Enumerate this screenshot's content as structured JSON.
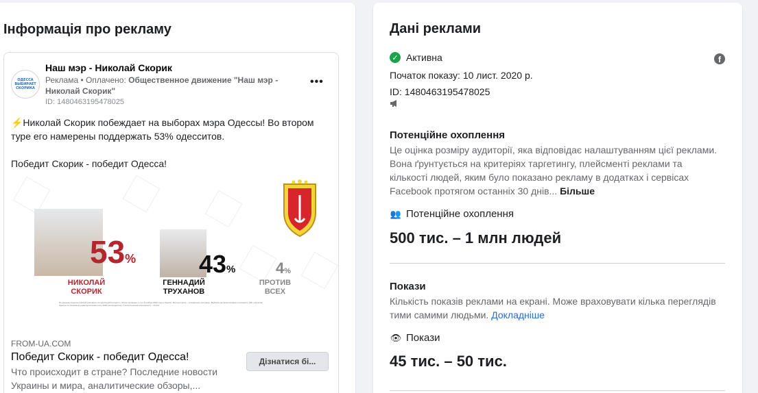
{
  "left": {
    "title": "Інформація про рекламу",
    "ad": {
      "avatar_text": [
        "ОДЕССА",
        "ВЫБИРАЕТ",
        "СКОРИКА"
      ],
      "page_name": "Наш мэр - Николай Скорик",
      "sponsor_prefix": "Реклама • Оплачено:",
      "sponsor_name": "Общественное движение \"Наш мэр - Николай Скорик\"",
      "ad_id": "ID: 1480463195478025",
      "more": "•••",
      "text_p1": "⚡Николай Скорик побеждает на выборах мэра Одессы! Во втором туре его намерены поддержать 53% одесситов.",
      "text_p2": "Победит Скорик - победит Одесса!",
      "creative": {
        "c1_pct": "53",
        "c1_name_line1": "НИКОЛАЙ",
        "c1_name_line2": "СКОРИК",
        "c2_pct": "43",
        "c2_name_line1": "ГЕННАДИЙ",
        "c2_name_line2": "ТРУХАНОВ",
        "c3_pct": "4",
        "c3_name_line1": "ПРОТИВ",
        "c3_name_line2": "ВСЕХ",
        "pct_sign": "%",
        "fine_print": "По данным социологической компании «Социальный Контекст». Опрос проведен с 1 по 6 ноября 2020 года в Одессе. Метод опроса – телефонное интервью. Выборка репрезентативна по возрасту (18+) жителям Одессы по основным характеристикам (полу 2000 респондентов). Статистическая погрешность – ±2.2%."
      },
      "domain": "FROM-UA.COM",
      "link_title": "Победит Скорик - победит Одесса!",
      "link_desc": "Что происходит в стране? Последние новости Украины и мира, аналитические обзоры,...",
      "cta": "Дізнатися бі..."
    }
  },
  "right": {
    "title": "Дані реклами",
    "status": "Активна",
    "start_date": "Початок показу: 10 лист. 2020 р.",
    "ad_id": "ID: 1480463195478025",
    "reach": {
      "title": "Потенційне охоплення",
      "desc": "Це оцінка розміру аудиторії, яка відповідає налаштуванням цієї реклами. Вона ґрунтується на критеріях таргетингу, плейсменті реклами та кількості людей, яким було показано рекламу в додатках і сервісах Facebook протягом останніх 30 днів...",
      "more_link": "Більше",
      "metric_label": "Потенційне охоплення",
      "metric_value": "500 тис. – 1 млн людей"
    },
    "impressions": {
      "title": "Покази",
      "desc": "Кількість показів реклами на екрані. Може враховувати кілька переглядів тими самими людьми.",
      "more_link": "Докладніше",
      "metric_label": "Покази",
      "metric_value": "45 тис. – 50 тис."
    }
  },
  "colors": {
    "active_green": "#1aa34a",
    "link_blue": "#216fdb",
    "percent_red": "#b3262e"
  }
}
